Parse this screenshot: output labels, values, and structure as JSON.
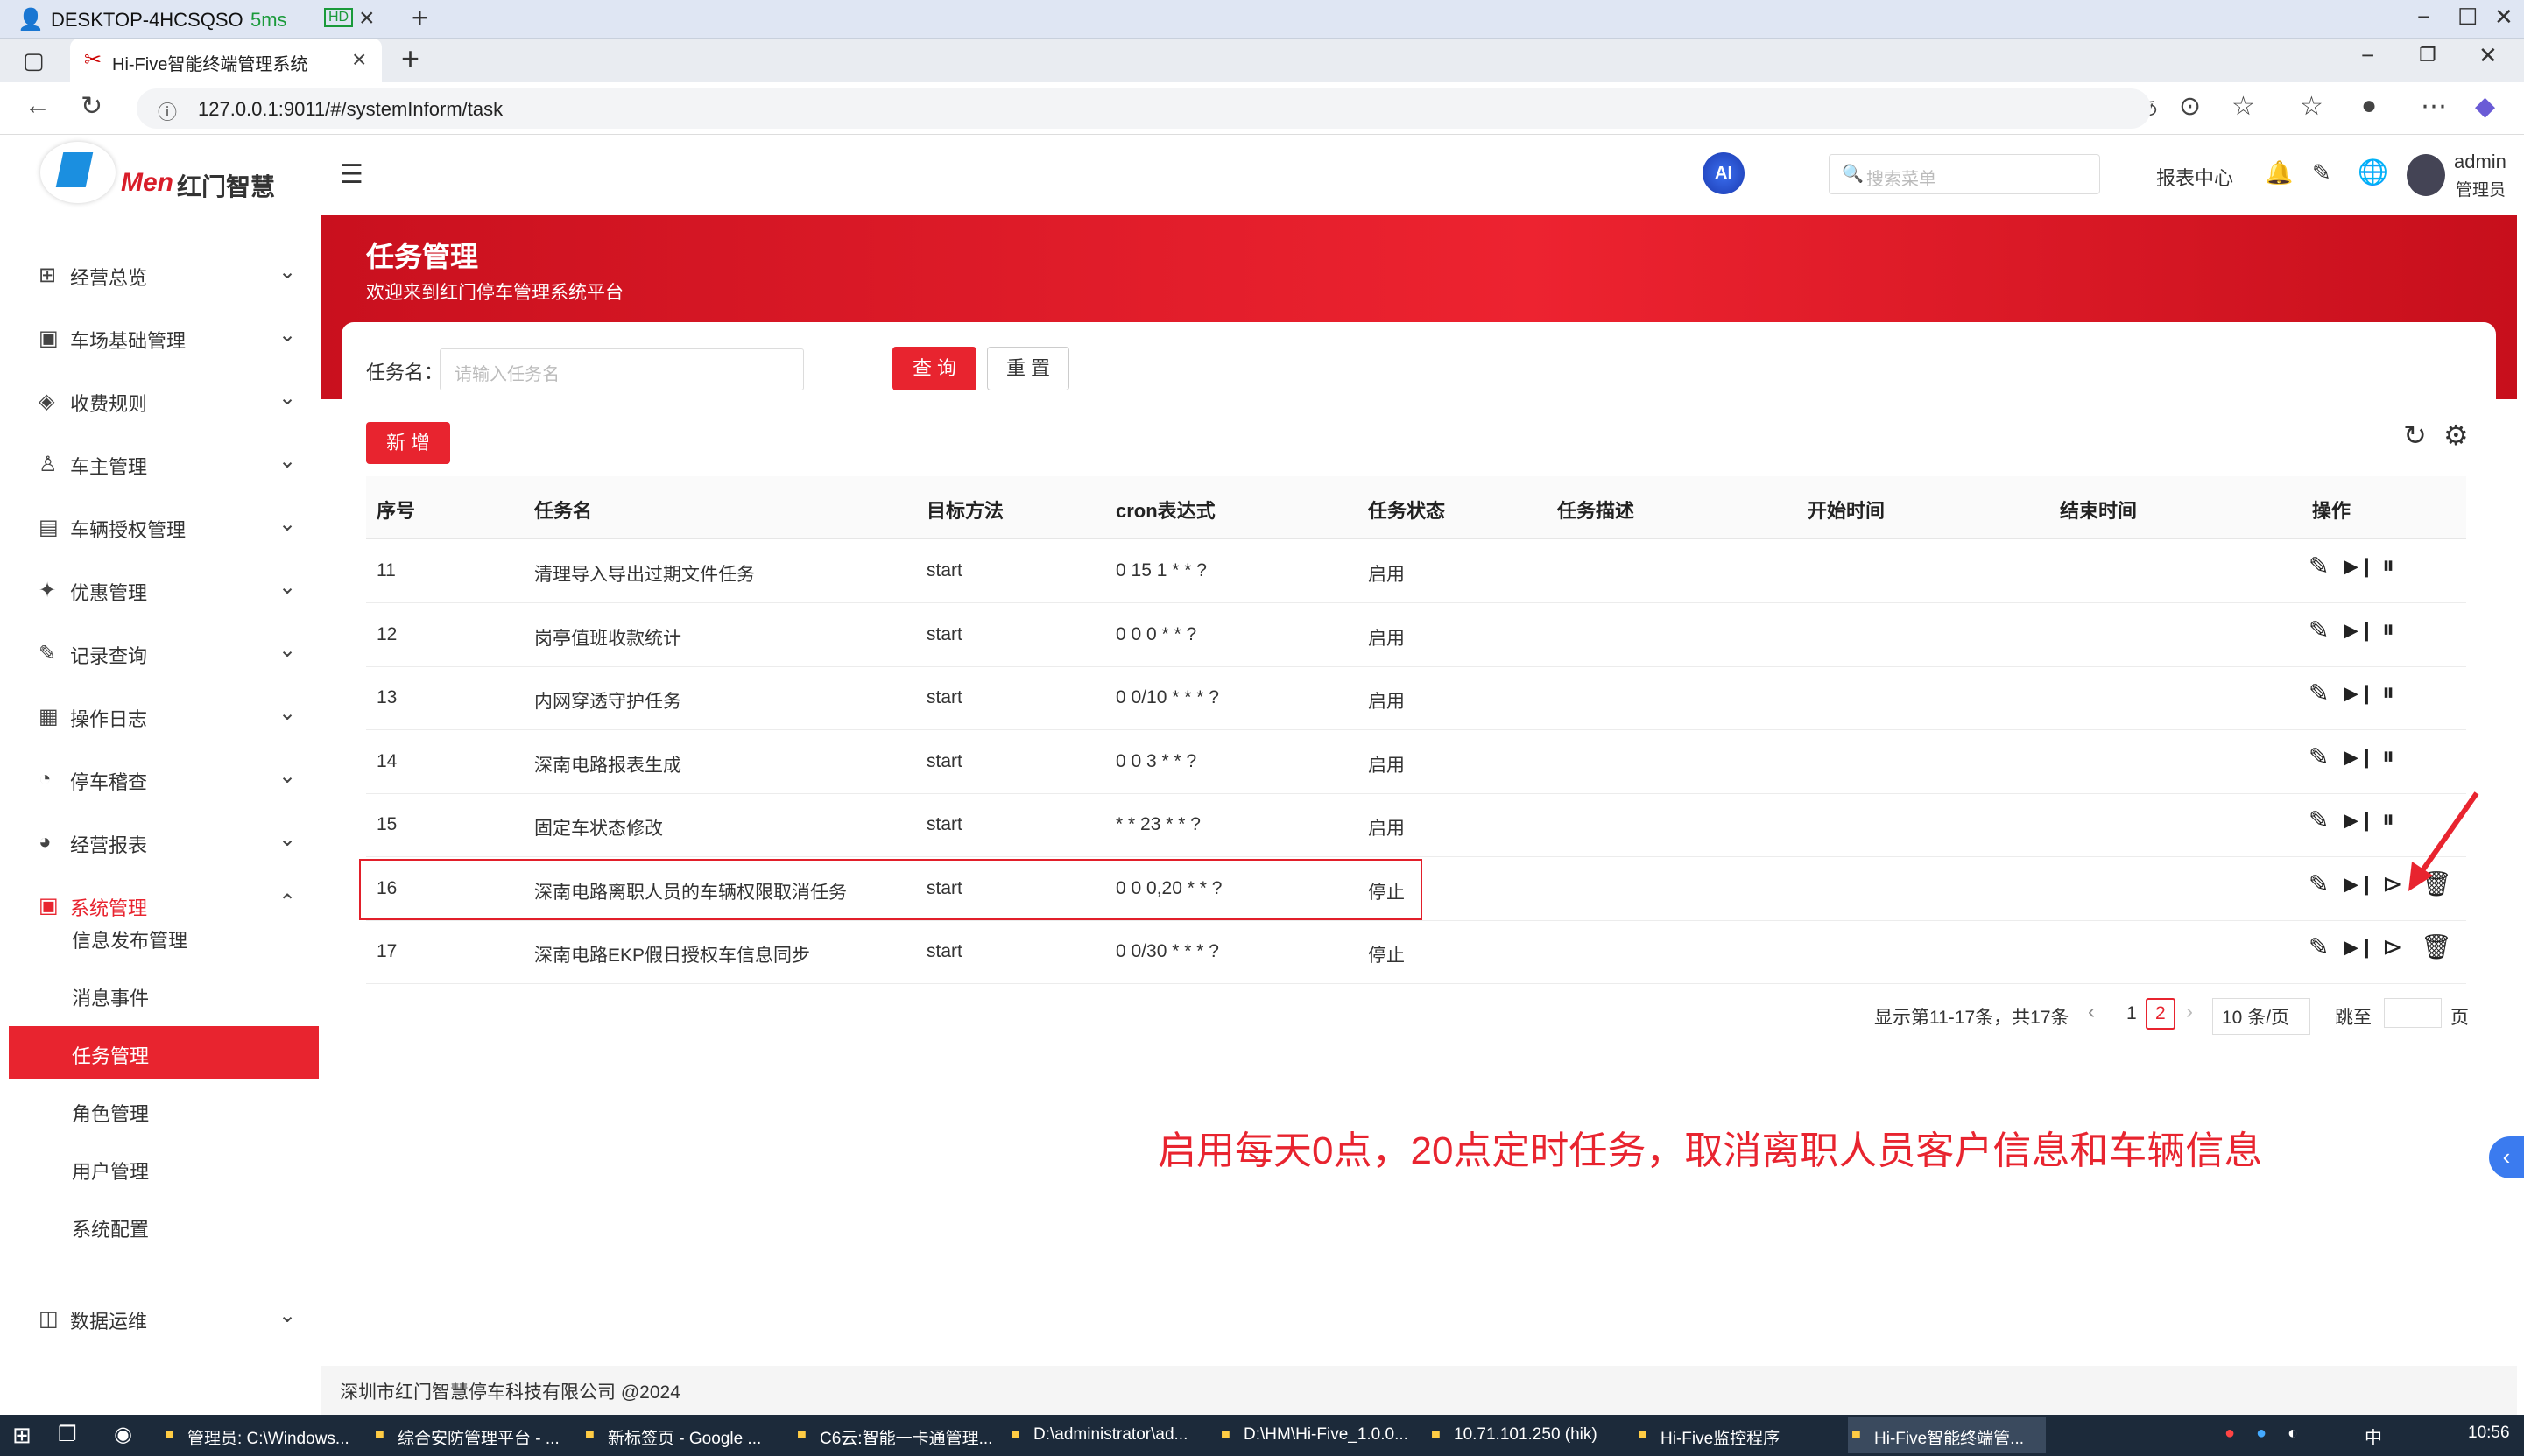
{
  "remote_bar": {
    "host": "DESKTOP-4HCSQSO",
    "latency": "5ms",
    "hd_badge": "HD"
  },
  "browser": {
    "tab_title": "Hi-Five智能终端管理系统",
    "url": "127.0.0.1:9011/#/systemInform/task"
  },
  "header": {
    "logo_text": "红门智慧",
    "logo_brand": "Men",
    "ai_label": "AI",
    "search_placeholder": "搜索菜单",
    "report_center": "报表中心",
    "username": "admin",
    "role": "管理员"
  },
  "sidebar": {
    "items": [
      {
        "label": "经营总览"
      },
      {
        "label": "车场基础管理"
      },
      {
        "label": "收费规则"
      },
      {
        "label": "车主管理"
      },
      {
        "label": "车辆授权管理"
      },
      {
        "label": "优惠管理"
      },
      {
        "label": "记录查询"
      },
      {
        "label": "操作日志"
      },
      {
        "label": "停车稽查"
      },
      {
        "label": "经营报表"
      },
      {
        "label": "系统管理"
      },
      {
        "label": "数据运维"
      }
    ],
    "sub_items": [
      {
        "label": "信息发布管理"
      },
      {
        "label": "消息事件"
      },
      {
        "label": "任务管理"
      },
      {
        "label": "角色管理"
      },
      {
        "label": "用户管理"
      },
      {
        "label": "系统配置"
      }
    ]
  },
  "page": {
    "title": "任务管理",
    "subtitle": "欢迎来到红门停车管理系统平台",
    "filter_label": "任务名：",
    "filter_placeholder": "请输入任务名",
    "query_btn": "查 询",
    "reset_btn": "重 置",
    "add_btn": "新 增"
  },
  "table": {
    "headers": [
      "序号",
      "任务名",
      "目标方法",
      "cron表达式",
      "任务状态",
      "任务描述",
      "开始时间",
      "结束时间",
      "操作"
    ],
    "rows": [
      {
        "id": "11",
        "name": "清理导入导出过期文件任务",
        "method": "start",
        "cron": "0 15 1 * * ?",
        "status": "启用"
      },
      {
        "id": "12",
        "name": "岗亭值班收款统计",
        "method": "start",
        "cron": "0 0 0 * * ?",
        "status": "启用"
      },
      {
        "id": "13",
        "name": "内网穿透守护任务",
        "method": "start",
        "cron": "0 0/10 * * * ?",
        "status": "启用"
      },
      {
        "id": "14",
        "name": "深南电路报表生成",
        "method": "start",
        "cron": "0 0 3 * * ?",
        "status": "启用"
      },
      {
        "id": "15",
        "name": "固定车状态修改",
        "method": "start",
        "cron": "* * 23 * * ?",
        "status": "启用"
      },
      {
        "id": "16",
        "name": "深南电路离职人员的车辆权限取消任务",
        "method": "start",
        "cron": "0 0 0,20 * * ?",
        "status": "停止"
      },
      {
        "id": "17",
        "name": "深南电路EKP假日授权车信息同步",
        "method": "start",
        "cron": "0 0/30 * * * ?",
        "status": "停止"
      }
    ]
  },
  "pagination": {
    "summary": "显示第11-17条，共17条",
    "page1": "1",
    "page2": "2",
    "page_size": "10 条/页",
    "jump_label": "跳至",
    "page_suffix": "页"
  },
  "annotation": "启用每天0点，20点定时任务，取消离职人员客户信息和车辆信息",
  "footer": "深圳市红门智慧停车科技有限公司 @2024",
  "taskbar": {
    "items": [
      "管理员: C:\\Windows...",
      "综合安防管理平台 - ...",
      "新标签页 - Google ...",
      "C6云:智能一卡通管理...",
      "D:\\administrator\\ad...",
      "D:\\HM\\Hi-Five_1.0.0...",
      "10.71.101.250 (hik)",
      "Hi-Five监控程序",
      "Hi-Five智能终端管..."
    ],
    "ime": "中",
    "clock": "10:56"
  },
  "colors": {
    "primary": "#e8242f",
    "sidebar_active": "#e8242f",
    "taskbar": "#1c2a3a"
  }
}
